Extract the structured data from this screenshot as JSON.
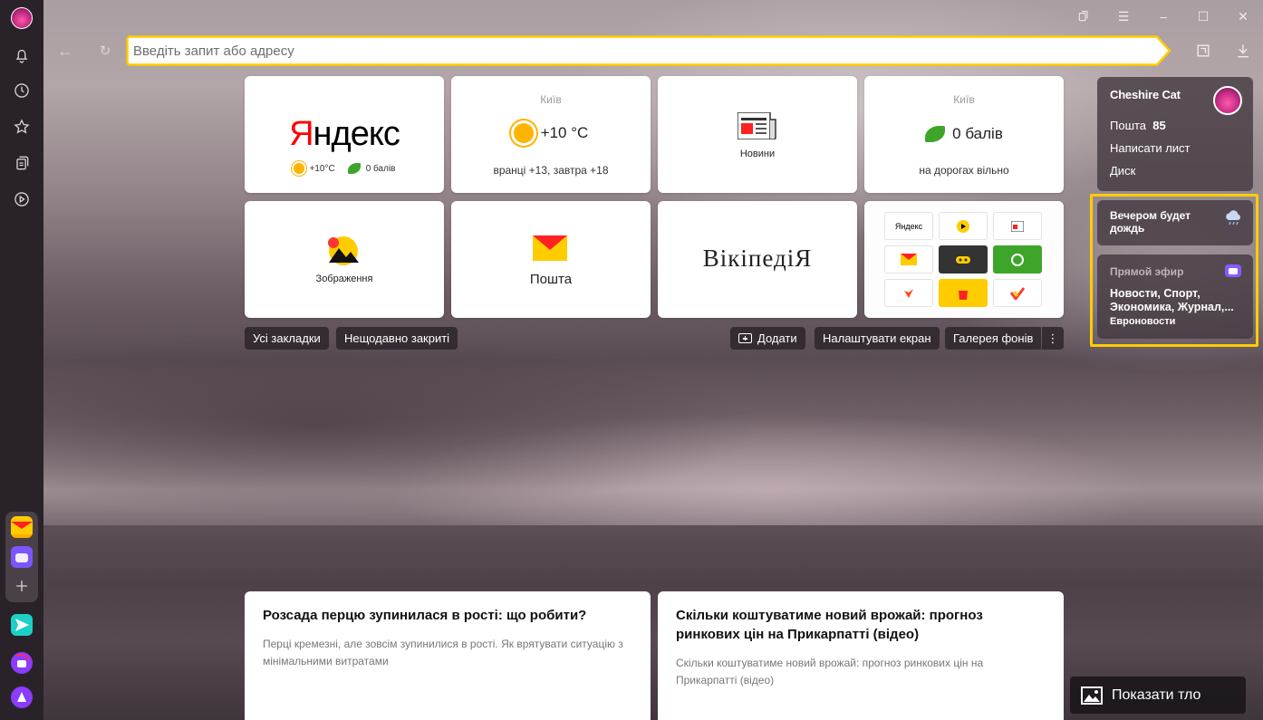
{
  "omnibox": {
    "placeholder": "Введіть запит або адресу"
  },
  "tiles": {
    "yandex": {
      "logo_first": "Я",
      "logo_rest": "ндекс",
      "weather": "+10°C",
      "score": "0 балів"
    },
    "weather": {
      "city": "Київ",
      "temp": "+10 °C",
      "forecast": "вранці +13, завтра +18"
    },
    "news": {
      "label": "Новини"
    },
    "traffic": {
      "city": "Київ",
      "score": "0 балів",
      "status": "на дорогах вільно"
    },
    "images": {
      "label": "Зображення"
    },
    "mail": {
      "label": "Пошта"
    },
    "wiki": {
      "label": "ВікіпедіЯ"
    },
    "grid": {
      "yandex_label": "Яндекс"
    }
  },
  "bar": {
    "bookmarks": "Усі закладки",
    "recent": "Нещодавно закриті",
    "add": "Додати",
    "customize": "Налаштувати екран",
    "gallery": "Галерея фонів",
    "more": "⋮"
  },
  "profile": {
    "name": "Cheshire Cat",
    "mail_label": "Пошта",
    "mail_count": "85",
    "write": "Написати лист",
    "disk": "Диск"
  },
  "weather_widget": {
    "line1": "Вечером будет",
    "line2": "дождь"
  },
  "live_widget": {
    "title": "Прямой эфир",
    "line1": "Новости, Спорт,",
    "line2": "Экономика, Журнал,...",
    "source": "Евроновости"
  },
  "cards": [
    {
      "title": "Розсада перцю зупинилася в рості: що робити?",
      "text": "Перці кремезні, але зовсім зупинилися в рості. Як врятувати ситуацію з мінімальними витратами"
    },
    {
      "title": "Скільки коштуватиме новий врожай: прогноз ринкових цін на Прикарпатті (відео)",
      "text": "Скільки коштуватиме новий врожай: прогноз ринкових цін на Прикарпатті (відео)"
    }
  ],
  "show_background": "Показати тло",
  "colors": {
    "accent": "#ffcc00",
    "yandex_red": "#ff0000",
    "sidebar": "#2a2229"
  }
}
